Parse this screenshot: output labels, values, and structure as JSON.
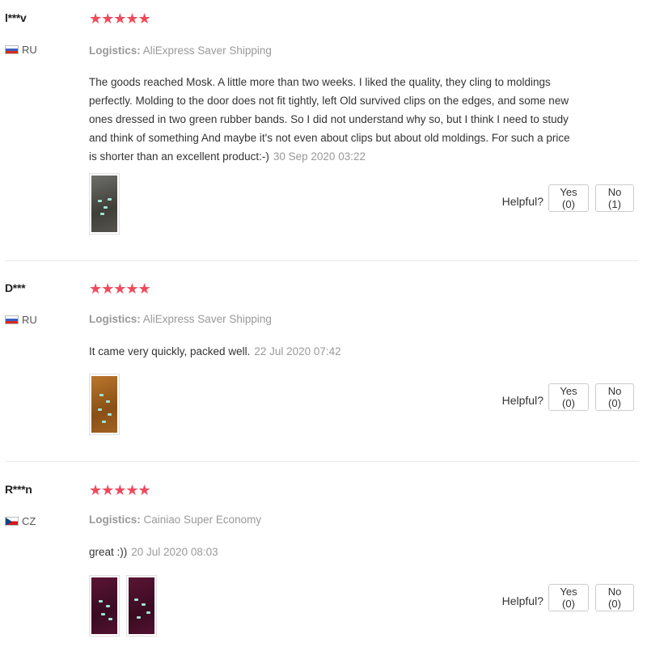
{
  "helpful_label": "Helpful?",
  "logistics_label": "Logistics:",
  "colors": {
    "star": "#f0495c",
    "muted": "#999999",
    "text": "#333333"
  },
  "reviews": [
    {
      "user": "l***v",
      "country": "RU",
      "flag_icon": "russia-flag-icon",
      "stars": "★★★★★",
      "rating": 5,
      "logistics": "AliExpress Saver Shipping",
      "text": "The goods reached Mosk. A little more than two weeks. I liked the quality, they cling to moldings perfectly. Molding to the door does not fit tightly, left Old survived clips on the edges, and some new ones dressed in two green rubber bands. So I did not understand why so, but I think I need to study and think of something And maybe it's not even about clips but about old moldings. For such a price is shorter than an excellent product:-)",
      "date": "30 Sep 2020 03:22",
      "yes": "Yes (0)",
      "no": "No (1)"
    },
    {
      "user": "D***",
      "country": "RU",
      "flag_icon": "russia-flag-icon",
      "stars": "★★★★★",
      "rating": 5,
      "logistics": "AliExpress Saver Shipping",
      "text": "It came very quickly, packed well.",
      "date": "22 Jul 2020 07:42",
      "yes": "Yes (0)",
      "no": "No (0)"
    },
    {
      "user": "R***n",
      "country": "CZ",
      "flag_icon": "czech-flag-icon",
      "stars": "★★★★★",
      "rating": 5,
      "logistics": "Cainiao Super Economy",
      "text": "great :))",
      "date": "20 Jul 2020 08:03",
      "yes": "Yes (0)",
      "no": "No (0)"
    }
  ]
}
